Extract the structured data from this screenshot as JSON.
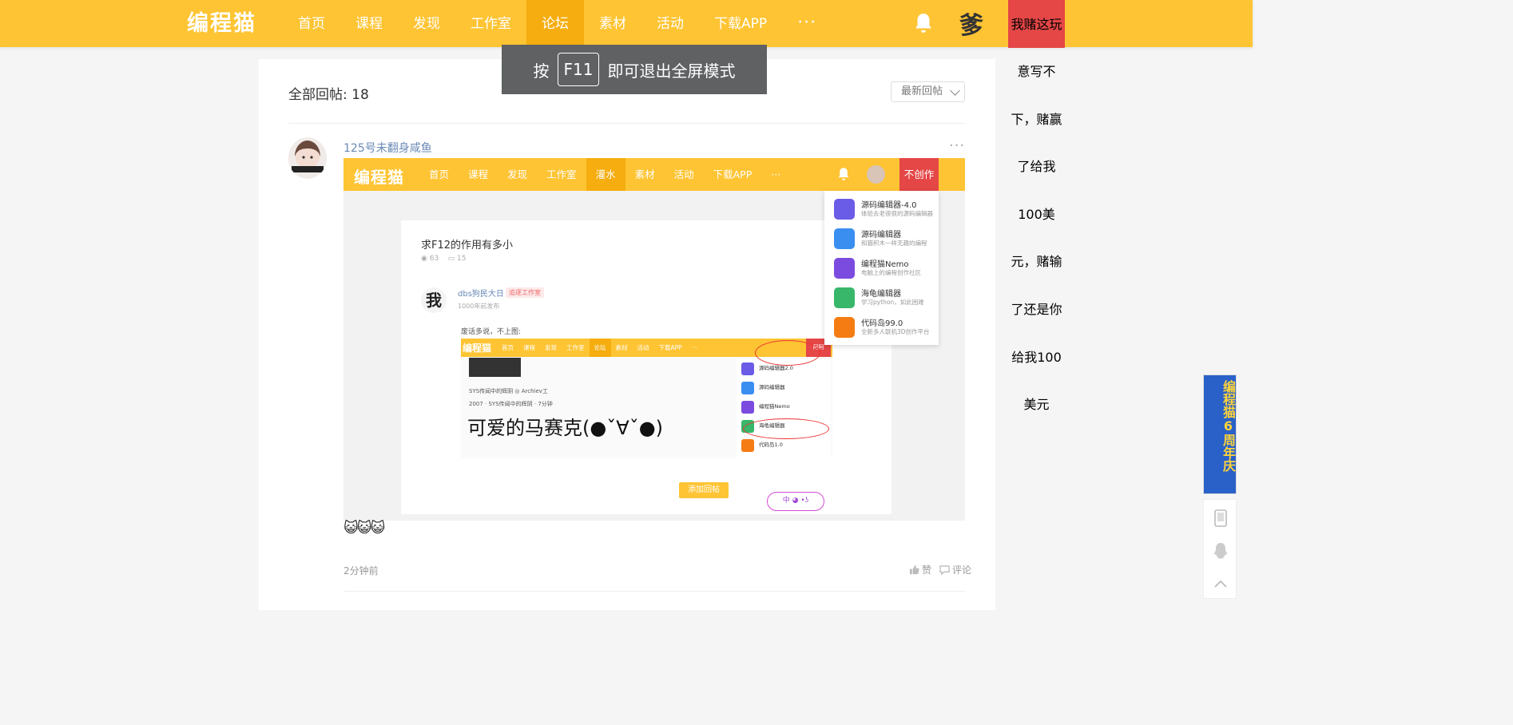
{
  "top_nav": {
    "logo": "编程猫",
    "items": [
      "首页",
      "课程",
      "发现",
      "工作室",
      "论坛",
      "素材",
      "活动",
      "下载APP"
    ],
    "active": "论坛",
    "more": "···",
    "avatar_glyph": "爹",
    "red_button": "我赌这玩"
  },
  "toast": {
    "prefix": "按",
    "key": "F11",
    "suffix": "即可退出全屏模式"
  },
  "thread": {
    "reply_count_label": "全部回帖: 18",
    "sort_label": "最新回帖"
  },
  "post": {
    "username": "125号未翻身咸鱼",
    "more": "···",
    "emojis": "😺😺😺",
    "time": "2分钟前",
    "like_label": "赞",
    "comment_label": "评论"
  },
  "embedded_screenshot": {
    "logo": "编程猫",
    "nav": [
      "首页",
      "课程",
      "发现",
      "工作室",
      "灌水",
      "素材",
      "活动",
      "下载APP",
      "···"
    ],
    "active": "灌水",
    "red_button": "不创作",
    "card_title": "求F12的作用有多小",
    "views": "63",
    "comments": "15",
    "author": "dbs狗民大日",
    "author_badge": "追逐工作室",
    "author_avatar": "我",
    "author_time": "1000年前发布",
    "caption": "废话多说，不上图:",
    "overlay_text": "可爱的马赛克(●ˇ∀ˇ●)",
    "add_reply": "添加回帖",
    "bubble": "中 ◕ •ʖ",
    "dropdown": [
      {
        "name": "源码编辑器-4.0",
        "desc": "体验去老很很的源码编辑器",
        "color": "#6b5ce7"
      },
      {
        "name": "源码编辑器",
        "desc": "和猫积木一样无趣的编程",
        "color": "#3a8ef0"
      },
      {
        "name": "编程猫Nemo",
        "desc": "电脑上的编程创作社区",
        "color": "#7b4be0"
      },
      {
        "name": "海龟编辑器",
        "desc": "学习python，如此困难",
        "color": "#38b66a"
      },
      {
        "name": "代码岛99.0",
        "desc": "全新多人联机3D创作平台",
        "color": "#f57c13"
      }
    ],
    "inner": {
      "logo": "编程猫",
      "nav": [
        "首页",
        "课程",
        "发现",
        "工作室",
        "论坛",
        "素材",
        "活动",
        "下载APP",
        "···"
      ],
      "red": "阿阿",
      "side": [
        "源码编辑器2.0",
        "源码编辑器",
        "编程猫Nemo",
        "海龟编辑器",
        "代码岛1.0"
      ],
      "lines": [
        "SYS传闻中的辉阴 ◎ Archiev工",
        "2007 · SYS传闻中的辉阴 · 7分钟"
      ]
    }
  },
  "side_text": [
    "意写不",
    "下，赌赢",
    "了给我",
    "100美",
    "元，赌输",
    "了还是你",
    "给我100",
    "美元"
  ],
  "promo": {
    "text": "编程猫6周年庆"
  }
}
